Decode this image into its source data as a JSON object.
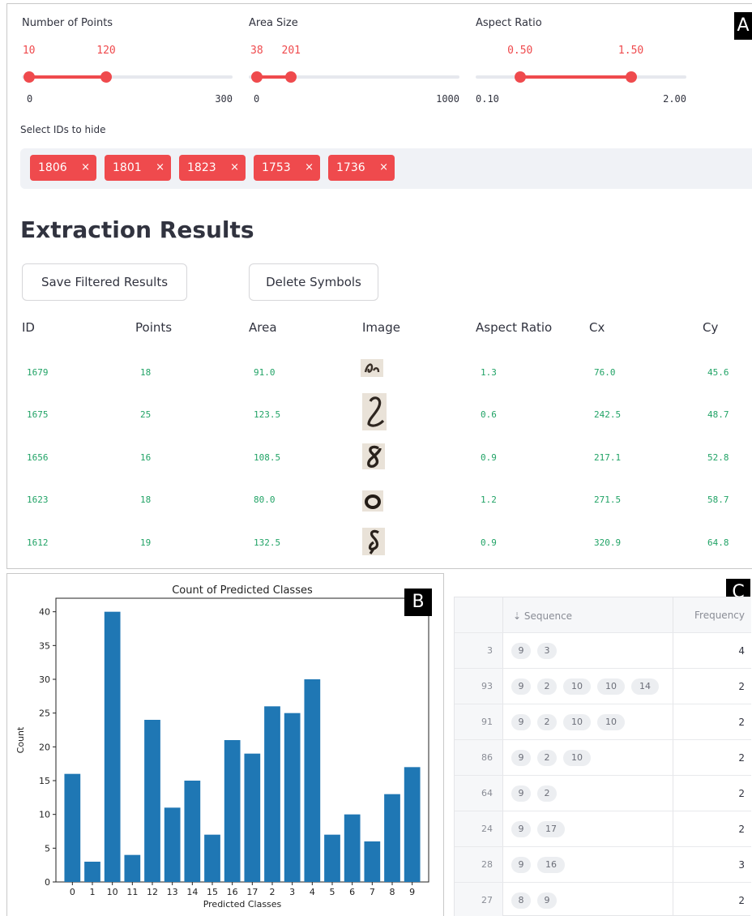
{
  "panel_a": {
    "tag": "A",
    "sliders": [
      {
        "label": "Number of Points",
        "low": "10",
        "high": "120",
        "min": "0",
        "max": "300",
        "low_value": 10,
        "high_value": 120,
        "range_min": 0,
        "range_max": 300
      },
      {
        "label": "Area Size",
        "low": "38",
        "high": "201",
        "min": "0",
        "max": "1000",
        "low_value": 38,
        "high_value": 201,
        "range_min": 0,
        "range_max": 1000
      },
      {
        "label": "Aspect Ratio",
        "low": "0.50",
        "high": "1.50",
        "min": "0.10",
        "max": "2.00",
        "low_value": 0.5,
        "high_value": 1.5,
        "range_min": 0.1,
        "range_max": 2.0
      }
    ],
    "multiselect": {
      "label": "Select IDs to hide",
      "chips": [
        "1806",
        "1801",
        "1823",
        "1753",
        "1736"
      ],
      "remove_glyph": "×"
    },
    "title": "Extraction Results",
    "buttons": {
      "save": "Save Filtered Results",
      "delete": "Delete Symbols"
    },
    "table": {
      "headers": [
        "ID",
        "Points",
        "Area",
        "Image",
        "Aspect Ratio",
        "Cx",
        "Cy"
      ],
      "rows": [
        [
          "1679",
          "18",
          "91.0",
          "",
          "1.3",
          "76.0",
          "45.6"
        ],
        [
          "1675",
          "25",
          "123.5",
          "",
          "0.6",
          "242.5",
          "48.7"
        ],
        [
          "1656",
          "16",
          "108.5",
          "",
          "0.9",
          "217.1",
          "52.8"
        ],
        [
          "1623",
          "18",
          "80.0",
          "",
          "1.2",
          "271.5",
          "58.7"
        ],
        [
          "1612",
          "19",
          "132.5",
          "",
          "0.9",
          "320.9",
          "64.8"
        ]
      ]
    }
  },
  "panel_b": {
    "tag": "B",
    "chart_data": {
      "type": "bar",
      "title": "Count of Predicted Classes",
      "xlabel": "Predicted Classes",
      "ylabel": "Count",
      "categories": [
        "0",
        "1",
        "10",
        "11",
        "12",
        "13",
        "14",
        "15",
        "16",
        "17",
        "2",
        "3",
        "4",
        "5",
        "6",
        "7",
        "8",
        "9"
      ],
      "values": [
        16,
        3,
        40,
        4,
        24,
        11,
        15,
        7,
        21,
        19,
        26,
        25,
        30,
        7,
        10,
        6,
        13,
        17
      ],
      "yticks": [
        "0",
        "5",
        "10",
        "15",
        "20",
        "25",
        "30",
        "35",
        "40"
      ],
      "ylim": [
        0,
        42
      ],
      "bar_color": "#1f77b4",
      "grid": false
    }
  },
  "panel_c": {
    "tag": "C",
    "headers": {
      "sequence": "⇣ Sequence",
      "frequency": "Frequency"
    },
    "rows": [
      {
        "index": "3",
        "sequence": [
          "9",
          "3"
        ],
        "frequency": "4"
      },
      {
        "index": "93",
        "sequence": [
          "9",
          "2",
          "10",
          "10",
          "14"
        ],
        "frequency": "2"
      },
      {
        "index": "91",
        "sequence": [
          "9",
          "2",
          "10",
          "10"
        ],
        "frequency": "2"
      },
      {
        "index": "86",
        "sequence": [
          "9",
          "2",
          "10"
        ],
        "frequency": "2"
      },
      {
        "index": "64",
        "sequence": [
          "9",
          "2"
        ],
        "frequency": "2"
      },
      {
        "index": "24",
        "sequence": [
          "9",
          "17"
        ],
        "frequency": "2"
      },
      {
        "index": "28",
        "sequence": [
          "9",
          "16"
        ],
        "frequency": "3"
      },
      {
        "index": "27",
        "sequence": [
          "8",
          "9"
        ],
        "frequency": "2"
      }
    ]
  }
}
